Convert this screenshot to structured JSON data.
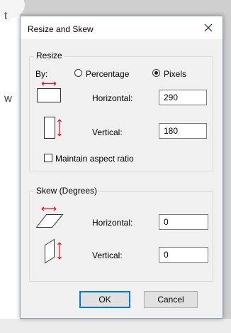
{
  "background": {
    "fragments": [
      "t",
      "w"
    ]
  },
  "dialog": {
    "title": "Resize and Skew",
    "close_icon": "close-icon",
    "resize": {
      "legend": "Resize",
      "by_label": "By:",
      "percentage_label": "Percentage",
      "pixels_label": "Pixels",
      "selected_mode": "Pixels",
      "horizontal_label": "Horizontal:",
      "horizontal_value": "290",
      "vertical_label": "Vertical:",
      "vertical_value": "180",
      "maintain_aspect_label": "Maintain aspect ratio",
      "maintain_aspect_checked": false
    },
    "skew": {
      "legend": "Skew (Degrees)",
      "horizontal_label": "Horizontal:",
      "horizontal_value": "0",
      "vertical_label": "Vertical:",
      "vertical_value": "0"
    },
    "ok_label": "OK",
    "cancel_label": "Cancel",
    "accent_color": "#0078d7",
    "arrow_color": "#e81123"
  }
}
